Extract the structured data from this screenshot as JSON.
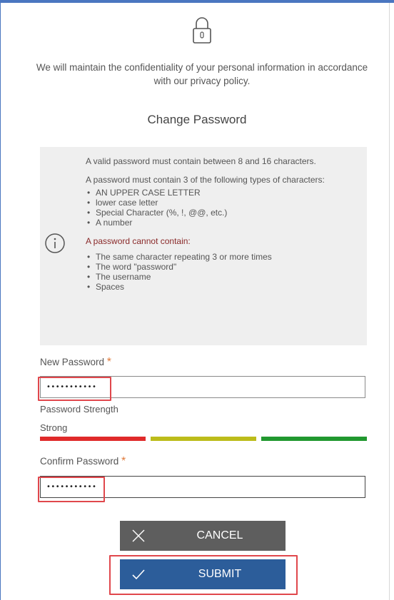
{
  "privacy_text": "We will maintain the confidentiality of your personal information in accordance with our privacy policy.",
  "title": "Change Password",
  "info": {
    "length_rule": "A valid password must contain between 8 and 16 characters.",
    "types_rule": "A password must contain 3 of the following types of characters:",
    "types": [
      "AN UPPER CASE LETTER",
      "lower case letter",
      "Special Character (%, !, @@, etc.)",
      "A number"
    ],
    "cannot_heading": "A password cannot contain:",
    "cannot": [
      "The same character repeating 3 or more times",
      "The word \"password\"",
      "The username",
      "Spaces"
    ]
  },
  "new_password": {
    "label": "New Password",
    "required_mark": "*",
    "value": "•••••••••••"
  },
  "strength": {
    "label": "Password Strength",
    "value": "Strong",
    "colors": [
      "#e02a2a",
      "#bcbc1a",
      "#21982f"
    ]
  },
  "confirm_password": {
    "label": "Confirm Password",
    "required_mark": "*",
    "value": "•••••••••••"
  },
  "buttons": {
    "cancel": "CANCEL",
    "submit": "SUBMIT"
  },
  "icons": {
    "lock": "lock-icon",
    "info": "info-icon",
    "cancel": "close-icon",
    "submit": "checkmark-icon"
  }
}
